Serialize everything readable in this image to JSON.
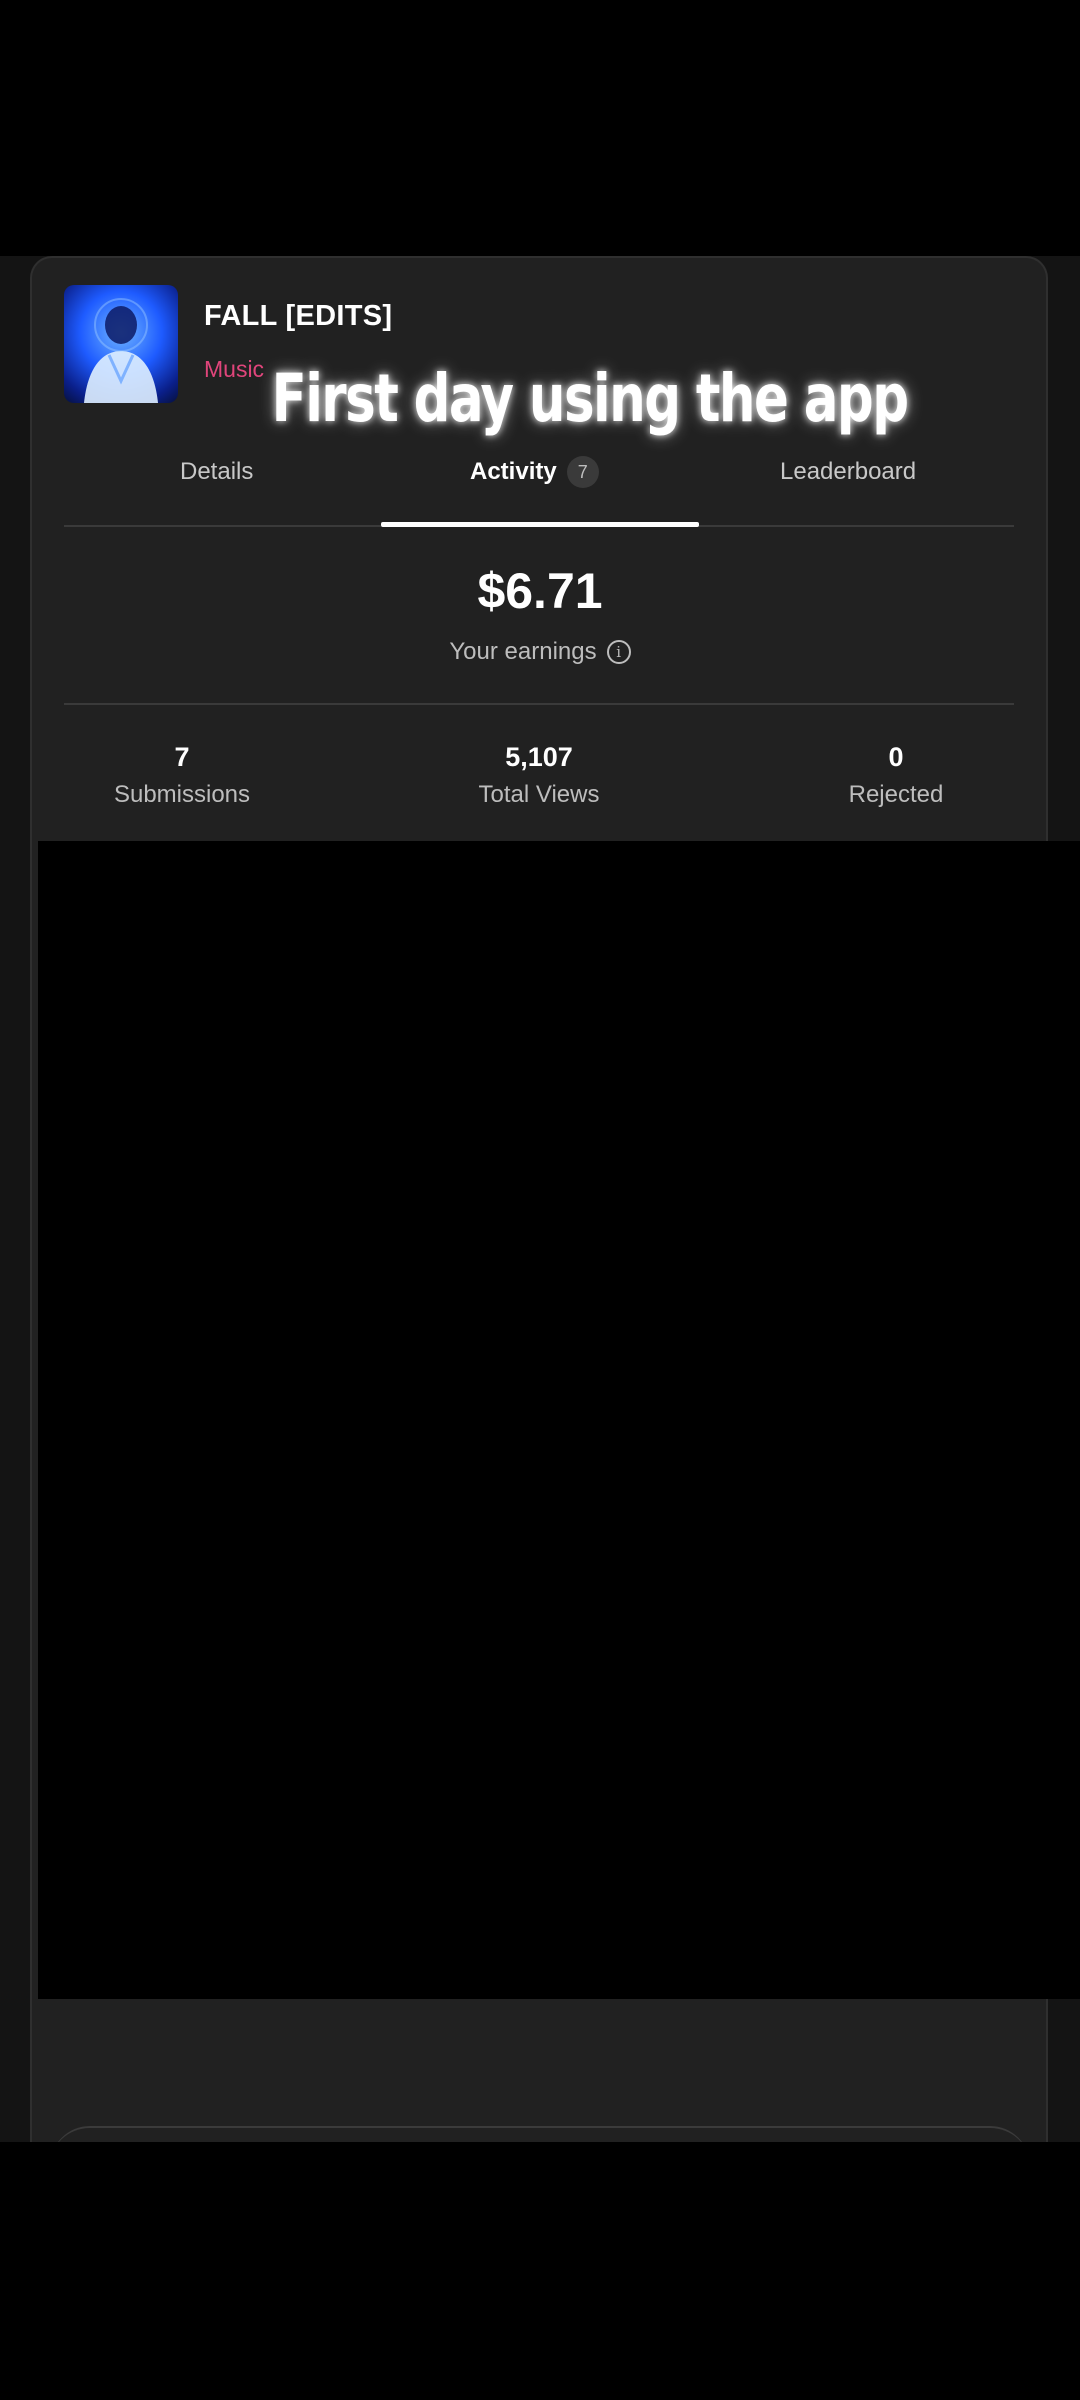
{
  "campaign": {
    "title": "FALL [EDITS]",
    "category": "Music",
    "category_color": "#e0457b",
    "cover_art": "blue-portrait-cover"
  },
  "overlay": {
    "caption": "First day using the app"
  },
  "tabs": [
    {
      "label": "Details",
      "active": false
    },
    {
      "label": "Activity",
      "active": true,
      "badge": "7"
    },
    {
      "label": "Leaderboard",
      "active": false
    }
  ],
  "earnings": {
    "amount": "$6.71",
    "label": "Your earnings",
    "info_icon": "info-icon"
  },
  "stats": [
    {
      "value": "7",
      "label": "Submissions"
    },
    {
      "value": "5,107",
      "label": "Total Views"
    },
    {
      "value": "0",
      "label": "Rejected"
    }
  ],
  "colors": {
    "background": "#000000",
    "card": "#212121",
    "accent": "#ffffff",
    "muted_text": "#bdbdbd"
  }
}
